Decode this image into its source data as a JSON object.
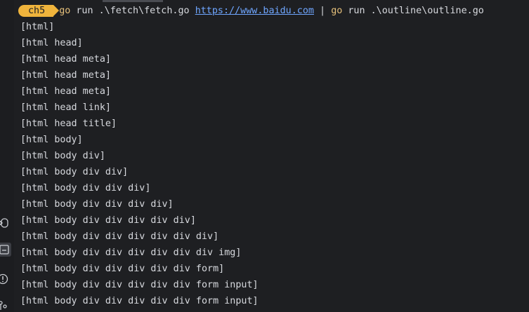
{
  "prompt": {
    "dir_badge": "ch5",
    "cmd1": "go",
    "args1": " run .\\fetch\\fetch.go ",
    "url": "https://www.baidu.com",
    "pipe": " | ",
    "cmd2": "go",
    "args2": " run .\\outline\\outline.go"
  },
  "output_lines": [
    "[html]",
    "[html head]",
    "[html head meta]",
    "[html head meta]",
    "[html head meta]",
    "[html head link]",
    "[html head title]",
    "[html body]",
    "[html body div]",
    "[html body div div]",
    "[html body div div div]",
    "[html body div div div div]",
    "[html body div div div div div]",
    "[html body div div div div div div]",
    "[html body div div div div div div img]",
    "[html body div div div div div form]",
    "[html body div div div div div form input]",
    "[html body div div div div div form input]"
  ],
  "activity_icons": [
    "output-icon",
    "terminal-icon",
    "info-icon",
    "source-control-icon"
  ],
  "colors": {
    "background": "#1e1f22",
    "badge": "#f0b43c",
    "command": "#e6c07b",
    "link": "#6fa6ff",
    "text": "#d7d9de"
  }
}
